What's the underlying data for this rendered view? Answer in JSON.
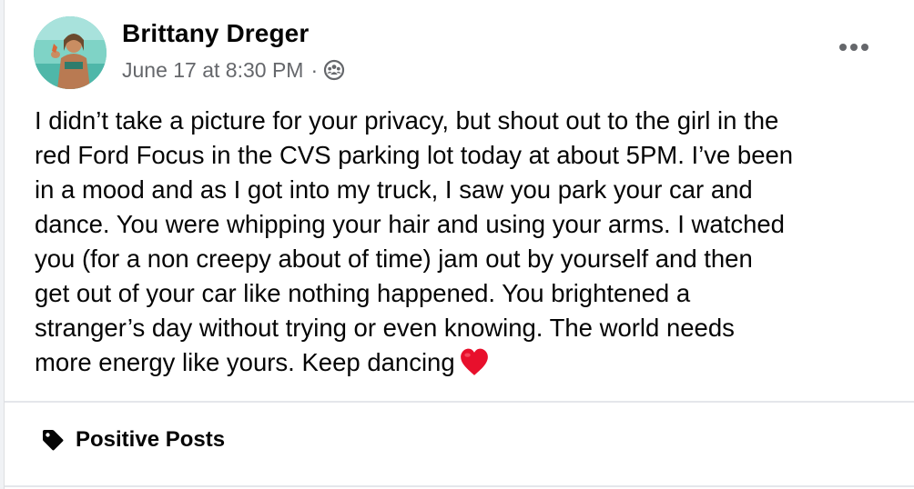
{
  "post": {
    "author": "Brittany Dreger",
    "timestamp": "June 17 at 8:30 PM",
    "separator": "·",
    "audience_icon": "friends-icon",
    "more_options_icon": "more-horizontal-icon",
    "text_lines": [
      "I didn’t take a picture for your privacy, but shout out to the girl in the",
      "red Ford Focus in the CVS parking lot today at about 5PM. I’ve been",
      "in a mood and as I got into my truck, I saw you park your car and",
      "dance. You were whipping your hair and using your arms. I watched",
      "you (for a non creepy about of time) jam out by yourself and then",
      "get out of your car like nothing happened. You brightened a",
      "stranger’s day without trying or even knowing. The world needs",
      "more energy like yours. Keep dancing"
    ],
    "emoji": "heart-emoji",
    "tag": {
      "icon": "tag-icon",
      "label": "Positive Posts"
    }
  },
  "colors": {
    "primary_text": "#050505",
    "secondary_text": "#65676b",
    "heart": "#e8102c",
    "divider": "#e4e6eb"
  }
}
